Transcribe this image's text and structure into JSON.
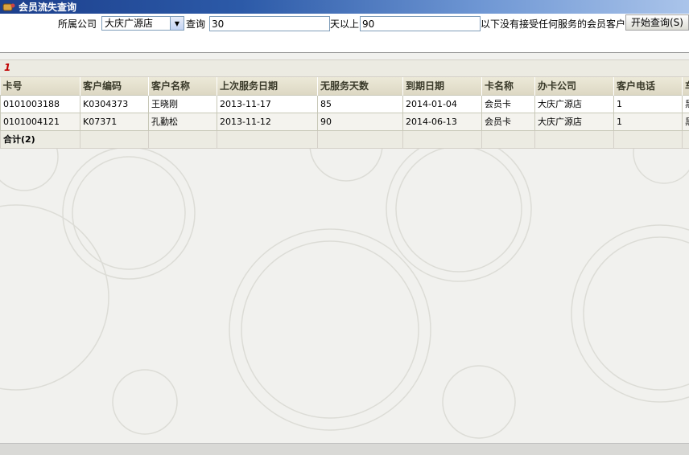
{
  "window": {
    "title": "会员流失查询"
  },
  "filter": {
    "company_label": "所属公司",
    "company_value": "大庆广源店",
    "query_label": "查询",
    "days_from": "30",
    "days_label": "天以上",
    "days_to": "90",
    "suffix_label": "以下没有接受任何服务的会员客户",
    "start_button": "开始查询(S)"
  },
  "pager": {
    "page": "1"
  },
  "table": {
    "columns": [
      "卡号",
      "客户编码",
      "客户名称",
      "上次服务日期",
      "无服务天数",
      "到期日期",
      "卡名称",
      "办卡公司",
      "客户电话",
      "车"
    ],
    "rows": [
      [
        "0101003188",
        "K0304373",
        "王晓刚",
        "2013-11-17",
        "85",
        "2014-01-04",
        "会员卡",
        "大庆广源店",
        "1",
        "黑"
      ],
      [
        "0101004121",
        "K07371",
        "孔勤松",
        "2013-11-12",
        "90",
        "2014-06-13",
        "会员卡",
        "大庆广源店",
        "1",
        "黑"
      ]
    ],
    "total_label": "合计(2)"
  }
}
